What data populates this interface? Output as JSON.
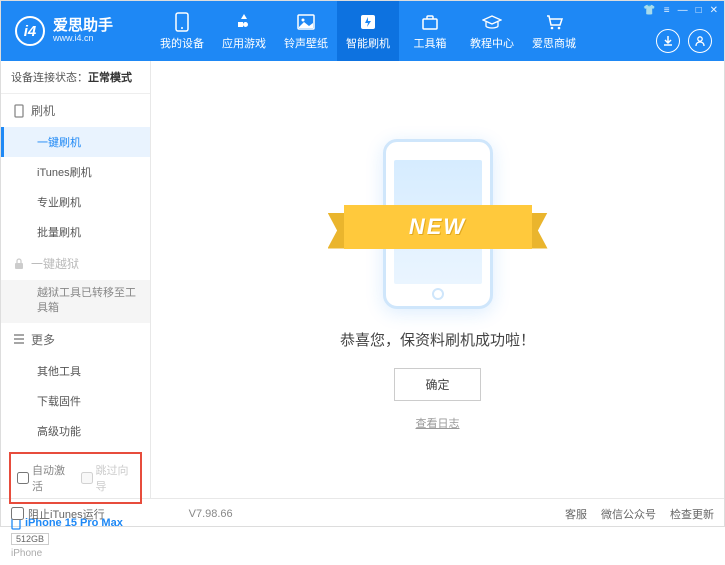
{
  "app": {
    "title": "爱思助手",
    "url": "www.i4.cn",
    "version": "V7.98.66"
  },
  "nav": {
    "items": [
      {
        "label": "我的设备"
      },
      {
        "label": "应用游戏"
      },
      {
        "label": "铃声壁纸"
      },
      {
        "label": "智能刷机"
      },
      {
        "label": "工具箱"
      },
      {
        "label": "教程中心"
      },
      {
        "label": "爱思商城"
      }
    ]
  },
  "status": {
    "prefix": "设备连接状态：",
    "value": "正常模式"
  },
  "sidebar": {
    "flash_section": "刷机",
    "flash_items": [
      "一键刷机",
      "iTunes刷机",
      "专业刷机",
      "批量刷机"
    ],
    "jailbreak_section": "一键越狱",
    "jailbreak_note": "越狱工具已转移至工具箱",
    "more_section": "更多",
    "more_items": [
      "其他工具",
      "下载固件",
      "高级功能"
    ],
    "checkbox1": "自动激活",
    "checkbox2": "跳过向导"
  },
  "device": {
    "name": "iPhone 15 Pro Max",
    "capacity": "512GB",
    "type": "iPhone"
  },
  "main": {
    "ribbon": "NEW",
    "message": "恭喜您，保资料刷机成功啦！",
    "ok": "确定",
    "view_log": "查看日志"
  },
  "footer": {
    "block_itunes": "阻止iTunes运行",
    "links": [
      "客服",
      "微信公众号",
      "检查更新"
    ]
  }
}
